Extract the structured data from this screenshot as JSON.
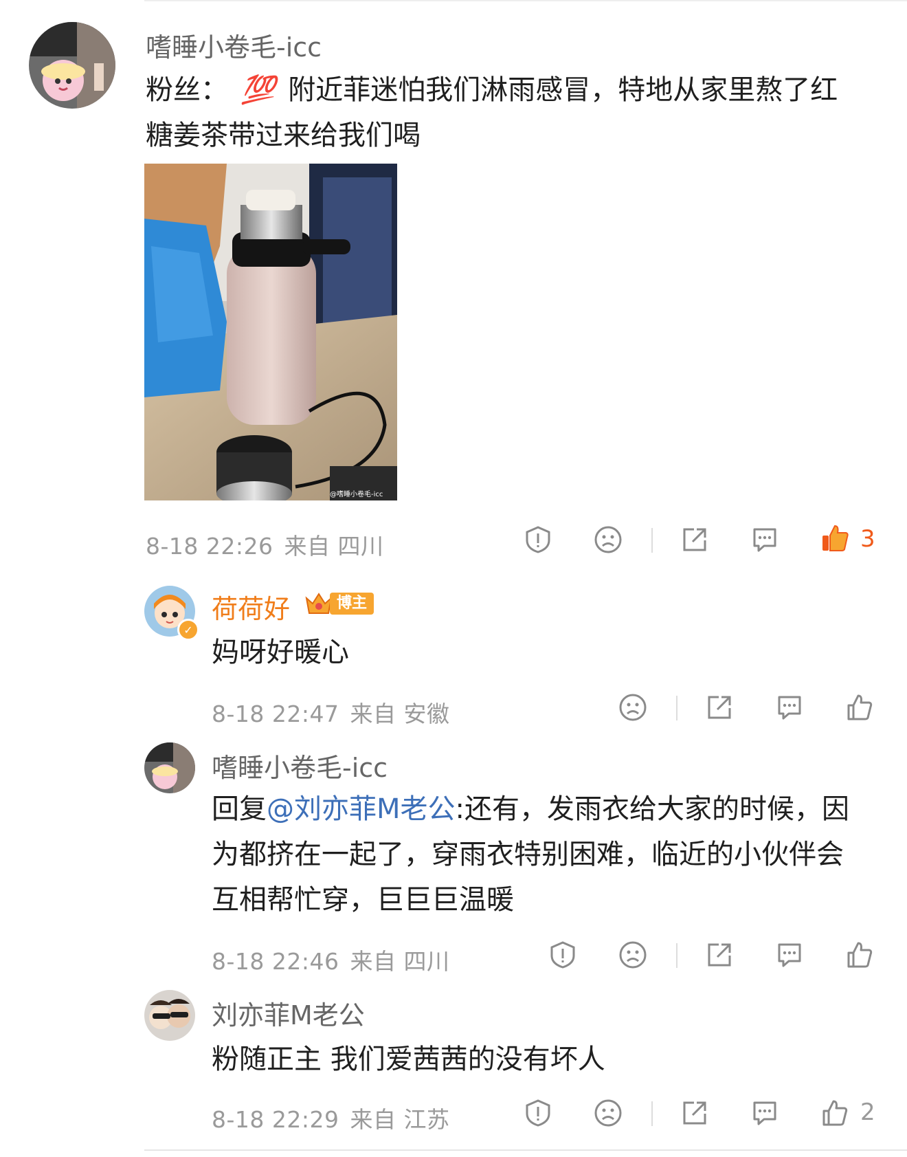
{
  "comments": [
    {
      "username": "嗜睡小卷毛-icc",
      "text_prefix": "粉丝：",
      "emoji": "💯",
      "text": " 附近菲迷怕我们淋雨感冒，特地从家里熬了红糖姜茶带过来给我们喝",
      "image_watermark": "@嗜睡小卷毛-icc",
      "date": "8-18 22:26",
      "source": "来自 四川",
      "like_count": "3"
    },
    {
      "username": "荷荷好",
      "badge": "博主",
      "text": "妈呀好暖心",
      "date": "8-18 22:47",
      "source": "来自 安徽"
    },
    {
      "username": "嗜睡小卷毛-icc",
      "reply_prefix": "回复",
      "mention": "@刘亦菲M老公",
      "text": ":还有，发雨衣给大家的时候，因为都挤在一起了，穿雨衣特别困难，临近的小伙伴会互相帮忙穿，巨巨巨温暖",
      "date": "8-18 22:46",
      "source": "来自 四川"
    },
    {
      "username": "刘亦菲M老公",
      "text": "粉随正主 我们爱茜茜的没有坏人",
      "date": "8-18 22:29",
      "source": "来自 江苏",
      "like_count": "2"
    }
  ],
  "colors": {
    "accent_orange": "#f07d1a",
    "like_active": "#f05a1a",
    "mention_blue": "#3d6fb8",
    "meta_gray": "#9a9a9a"
  },
  "icons": [
    "report-icon",
    "dislike-face-icon",
    "share-icon",
    "comment-icon",
    "like-thumb-icon"
  ]
}
